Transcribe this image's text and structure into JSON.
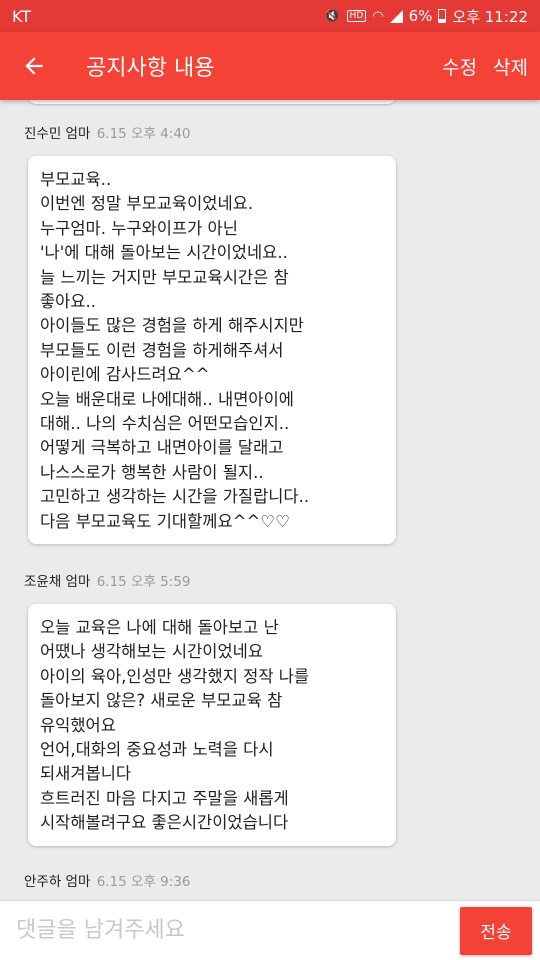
{
  "status_bar": {
    "carrier": "KT",
    "battery": "6%",
    "time": "오후 11:22"
  },
  "app_bar": {
    "back_icon": "←",
    "title": "공지사항 내용",
    "edit_label": "수정",
    "delete_label": "삭제"
  },
  "comments": [
    {
      "author": "진수민 엄마",
      "time": "6.15 오후 4:40",
      "text": "부모교육..\n이번엔 정말 부모교육이었네요.\n누구엄마. 누구와이프가 아닌\n'나'에 대해 돌아보는 시간이었네요..\n늘 느끼는 거지만 부모교육시간은 참\n좋아요..\n아이들도 많은 경험을 하게 해주시지만\n부모들도 이런 경험을 하게해주셔서\n아이린에 감사드려요^^\n오늘 배운대로 나에대해.. 내면아이에\n대해.. 나의 수치심은 어떤모습인지..\n어떻게 극복하고 내면아이를 달래고\n나스스로가 행복한 사람이 될지..\n고민하고 생각하는 시간을 가질랍니다..\n다음 부모교육도 기대할께요^^♡♡"
    },
    {
      "author": "조윤채 엄마",
      "time": "6.15 오후 5:59",
      "text": "오늘 교육은 나에 대해 돌아보고 난\n어땠나 생각해보는 시간이었네요\n아이의 육아,인성만 생각했지 정작 나를\n돌아보지 않은? 새로운 부모교육 참\n유익했어요\n언어,대화의 중요성과 노력을 다시\n되새겨봅니다\n흐트러진 마음 다지고 주말을 새롭게\n시작해볼려구요 좋은시간이었습니다"
    },
    {
      "author": "안주하 엄마",
      "time": "6.15 오후 9:36"
    }
  ],
  "input_bar": {
    "placeholder": "댓글을 남겨주세요",
    "value": "",
    "send_label": "전송"
  },
  "colors": {
    "status_bar": "#e53935",
    "app_bar": "#f44336",
    "background": "#ebebeb",
    "send_button": "#f44336"
  }
}
